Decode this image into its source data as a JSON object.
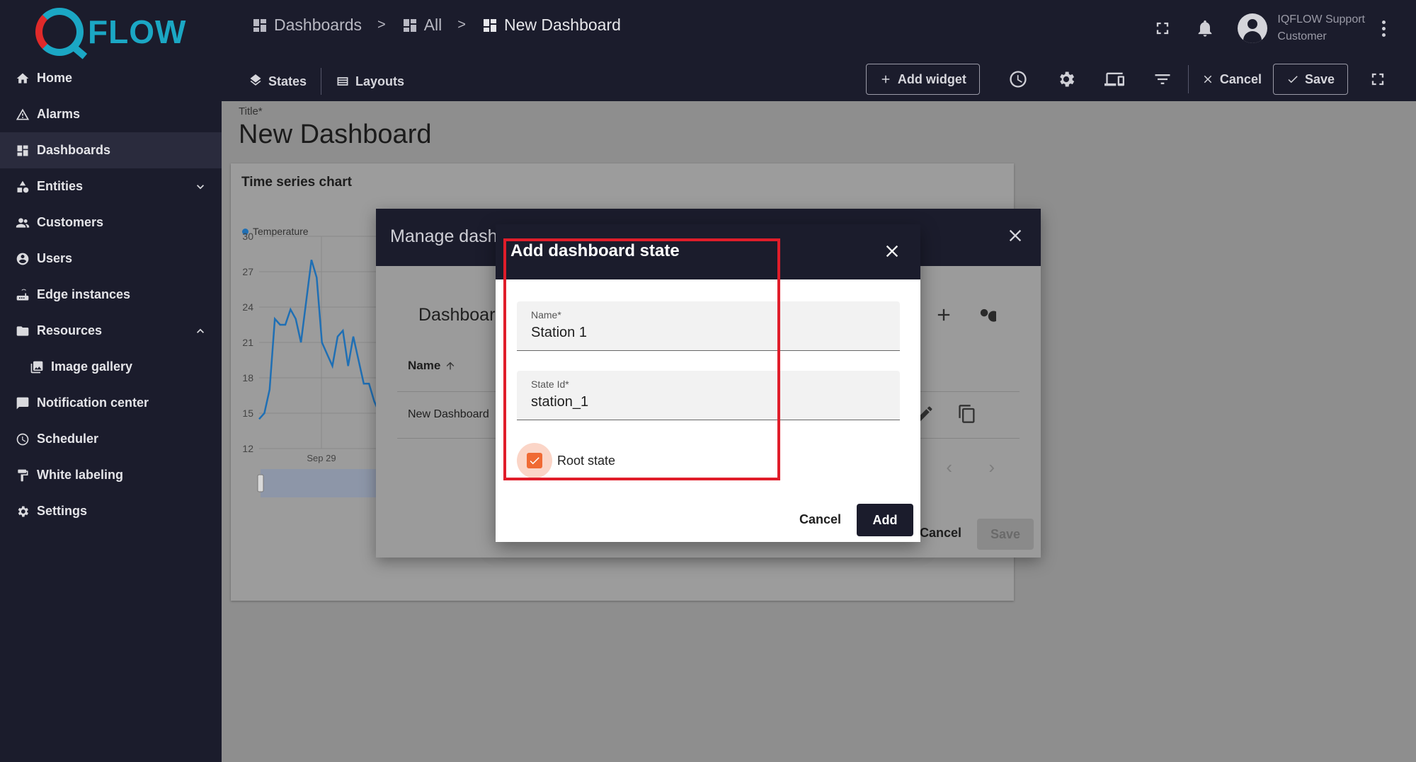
{
  "brand": {
    "logo_text": "FLOW"
  },
  "sidebar": {
    "items": [
      {
        "label": "Home",
        "icon": "home-icon"
      },
      {
        "label": "Alarms",
        "icon": "warning-icon"
      },
      {
        "label": "Dashboards",
        "icon": "dashboard-icon",
        "active": true
      },
      {
        "label": "Entities",
        "icon": "entities-icon",
        "chevron": "down"
      },
      {
        "label": "Customers",
        "icon": "customers-icon"
      },
      {
        "label": "Users",
        "icon": "user-icon"
      },
      {
        "label": "Edge instances",
        "icon": "router-icon"
      },
      {
        "label": "Resources",
        "icon": "folder-icon",
        "chevron": "up"
      },
      {
        "label": "Image gallery",
        "icon": "gallery-icon",
        "sub": true
      },
      {
        "label": "Notification center",
        "icon": "notification-center-icon"
      },
      {
        "label": "Scheduler",
        "icon": "clock-icon"
      },
      {
        "label": "White labeling",
        "icon": "paint-roller-icon"
      },
      {
        "label": "Settings",
        "icon": "gear-icon"
      }
    ]
  },
  "breadcrumb": {
    "items": [
      "Dashboards",
      "All",
      "New Dashboard"
    ],
    "separator": ">"
  },
  "user": {
    "name": "IQFLOW Support",
    "role": "Customer"
  },
  "toolbar": {
    "states_label": "States",
    "layouts_label": "Layouts",
    "add_widget_label": "Add widget",
    "cancel_label": "Cancel",
    "save_label": "Save"
  },
  "page": {
    "title_label": "Title*",
    "title_value": "New Dashboard"
  },
  "widget": {
    "title": "Time series chart"
  },
  "chart_data": {
    "type": "line",
    "title": "Time series chart",
    "series": [
      {
        "name": "Temperature",
        "color": "#1f6fb4",
        "values": [
          14.5,
          15.0,
          17.0,
          23.0,
          22.5,
          22.5,
          23.8,
          23.0,
          21.0,
          24.5,
          28.0,
          26.5,
          21.0,
          20.0,
          19.0,
          21.5,
          22.0,
          19.0,
          21.5,
          19.5,
          17.5,
          17.5,
          16.0,
          15.0
        ]
      }
    ],
    "x_tick_labels": [
      "Sep 29"
    ],
    "y_ticks": [
      30,
      27,
      24,
      21,
      18,
      15,
      12
    ],
    "ylim": [
      12,
      30
    ],
    "grid": true
  },
  "manage_dialog": {
    "title": "Manage dash",
    "subtitle": "Dashboar",
    "column_name": "Name",
    "rows": [
      "New Dashboard"
    ],
    "cancel_label": "Cancel",
    "save_label": "Save"
  },
  "add_state_dialog": {
    "title": "Add dashboard state",
    "name_label": "Name*",
    "name_value": "Station 1",
    "state_id_label": "State Id*",
    "state_id_value": "station_1",
    "root_state_label": "Root state",
    "root_state_checked": true,
    "cancel_label": "Cancel",
    "add_label": "Add"
  },
  "colors": {
    "sidebar_bg": "#1b1c2c",
    "accent": "#f06a34",
    "highlight": "#e01d2a"
  }
}
